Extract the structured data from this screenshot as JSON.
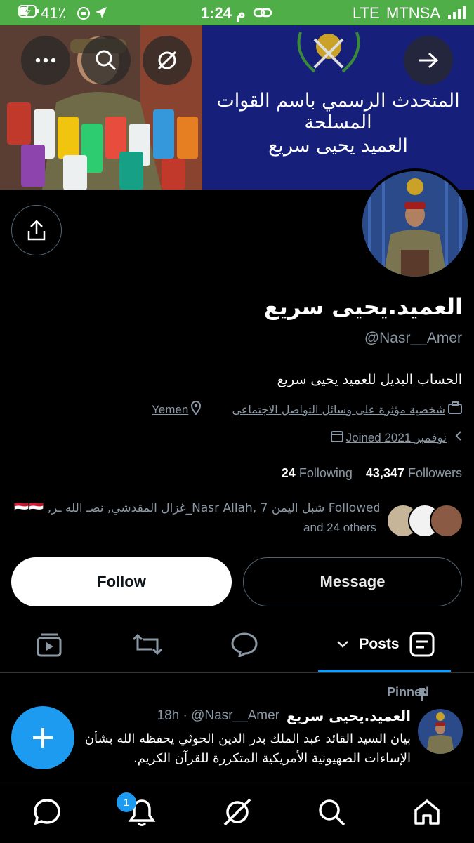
{
  "status_bar": {
    "battery": "41٪",
    "time": "1:24 م",
    "network": "LTE",
    "carrier": "MTNSA"
  },
  "banner": {
    "line1": "المتحدث الرسمي باسم القوات المسلحة",
    "line2": "العميد يحيى سريع"
  },
  "profile": {
    "name": "العميد.يحيى سريع",
    "handle": "@Nasr__Amer",
    "bio": "الحساب البديل للعميد يحيى سريع",
    "category": "شخصية مؤثرة على وسائل التواصل الاجتماعي",
    "location": "Yemen",
    "joined": "Joined 2021 نوفمبر",
    "following_count": "24",
    "following_label": "Following",
    "followers_count": "43,347",
    "followers_label": "Followers",
    "followed_by_line1": "🇾🇪🇾🇪 ,غزال المقدشي, نصـ الله ـر_Nasr Allah, شبل اليمن 7 Followed by",
    "followed_by_line2": "and 24 others"
  },
  "actions": {
    "follow": "Follow",
    "message": "Message"
  },
  "tabs": {
    "posts": "Posts"
  },
  "post": {
    "pinned": "Pinned",
    "author": "العميد.يحيى سريع",
    "meta": "18h · @Nasr__Amer",
    "line1": "بيان السيد القائد عبد الملك بدر الدين الحوثي يحفظه الله بشأن",
    "line2": "الإساءات الصهيونية الأمريكية المتكررة للقرآن الكريم."
  },
  "nav": {
    "notification_badge": "1"
  },
  "colors": {
    "accent": "#1d9bf0",
    "status_bar": "#4fae48"
  }
}
